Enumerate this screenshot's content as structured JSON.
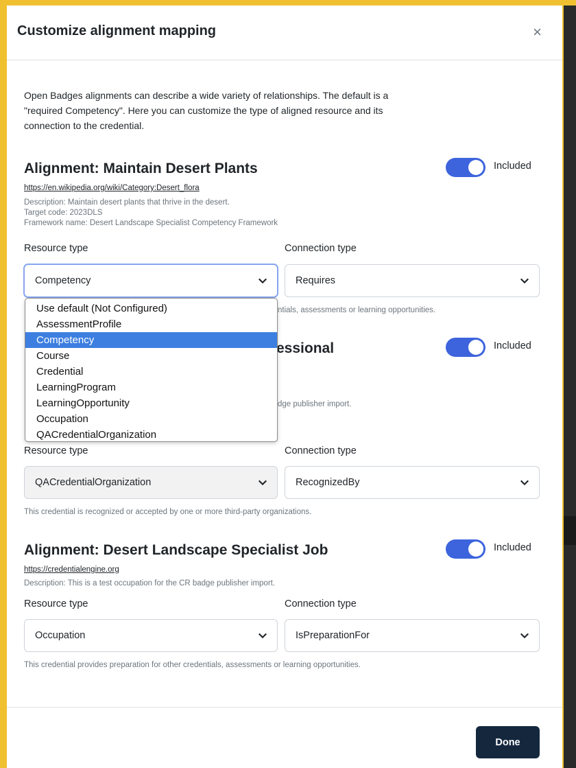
{
  "modal": {
    "title": "Customize alignment mapping",
    "close_icon": "×",
    "intro": "Open Badges alignments can describe a wide variety of relationships. The default is a \"required Competency\". Here you can customize the type of aligned resource and its connection to the credential.",
    "done_label": "Done"
  },
  "labels": {
    "resource_type": "Resource type",
    "connection_type": "Connection type",
    "included": "Included"
  },
  "alignments": [
    {
      "title": "Alignment: Maintain Desert Plants",
      "link": "https://en.wikipedia.org/wiki/Category:Desert_flora",
      "description": "Description: Maintain desert plants that thrive in the desert.",
      "target_code": "Target code: 2023DLS",
      "framework": "Framework name: Desert Landscape Specialist Competency Framework",
      "resource_type": "Competency",
      "connection_type": "Requires",
      "help_partial": "ntials, assessments or learning opportunities.",
      "included": true
    },
    {
      "title_partial": "fessional",
      "desc_partial": "dge publisher import.",
      "resource_type": "QACredentialOrganization",
      "connection_type": "RecognizedBy",
      "help": "This credential is recognized or accepted by one or more third-party organizations.",
      "included": true
    },
    {
      "title": "Alignment: Desert Landscape Specialist Job",
      "link": "https://credentialengine.org",
      "description": "Description: This is a test occupation for the CR badge publisher import.",
      "resource_type": "Occupation",
      "connection_type": "IsPreparationFor",
      "help": "This credential provides preparation for other credentials, assessments or learning opportunities.",
      "included": true
    }
  ],
  "dropdown": {
    "options": [
      "Use default (Not Configured)",
      "AssessmentProfile",
      "Competency",
      "Course",
      "Credential",
      "LearningProgram",
      "LearningOpportunity",
      "Occupation",
      "QACredentialOrganization"
    ],
    "selected": "Competency"
  },
  "colors": {
    "frame": "#f0c030",
    "toggle_on": "#3d64dd",
    "selected_option": "#3d7fe0",
    "done_button": "#14273d"
  }
}
